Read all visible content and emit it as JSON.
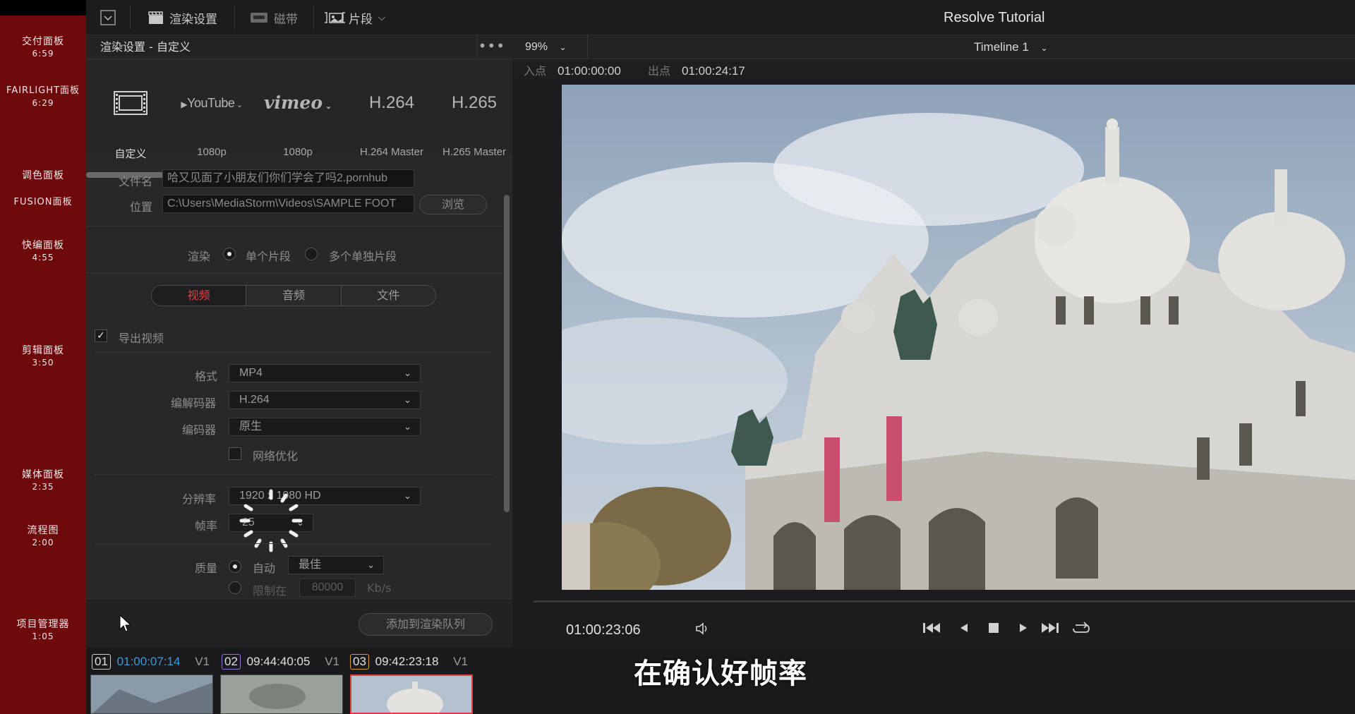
{
  "chapters": [
    {
      "label": "交付面板",
      "time": "6:59"
    },
    {
      "label": "FAIRLIGHT面板",
      "time": "6:29"
    },
    {
      "label": "调色面板",
      "time": ""
    },
    {
      "label": "FUSION面板",
      "time": ""
    },
    {
      "label": "快编面板",
      "time": "4:55"
    },
    {
      "label": "剪辑面板",
      "time": "3:50"
    },
    {
      "label": "媒体面板",
      "time": "2:35"
    },
    {
      "label": "流程图",
      "time": "2:00"
    },
    {
      "label": "项目管理器",
      "time": "1:05"
    }
  ],
  "toolbar": {
    "render_settings": "渲染设置",
    "tape": "磁带",
    "clips": "片段",
    "app_title": "Resolve Tutorial"
  },
  "render_panel": {
    "title": "渲染设置 - 自定义",
    "more": "•••",
    "presets": [
      {
        "logo": "film",
        "caption": "自定义"
      },
      {
        "logo": "YouTube",
        "caption": "1080p"
      },
      {
        "logo": "vimeo",
        "caption": "1080p"
      },
      {
        "logo": "H.264",
        "caption": "H.264 Master"
      },
      {
        "logo": "H.265",
        "caption": "H.265 Master"
      }
    ],
    "filename_label": "文件名",
    "filename_value": "哈又见面了小朋友们你们学会了吗2.pornhub",
    "location_label": "位置",
    "location_value": "C:\\Users\\MediaStorm\\Videos\\SAMPLE FOOT",
    "browse": "浏览",
    "render_label": "渲染",
    "render_single": "单个片段",
    "render_multiple": "多个单独片段",
    "tabs": [
      "视频",
      "音频",
      "文件"
    ],
    "export_video": "导出视频",
    "format_label": "格式",
    "format_value": "MP4",
    "codec_label": "编解码器",
    "codec_value": "H.264",
    "encoder_label": "编码器",
    "encoder_value": "原生",
    "network_opt": "网络优化",
    "resolution_label": "分辨率",
    "resolution_value": "1920 x 1080 HD",
    "framerate_label": "帧率",
    "framerate_value": "25",
    "quality_label": "质量",
    "quality_auto": "自动",
    "quality_value": "最佳",
    "limit_label": "限制在",
    "limit_value": "80000",
    "limit_unit": "Kb/s",
    "add_queue": "添加到渲染队列"
  },
  "viewer": {
    "zoom": "99%",
    "timeline": "Timeline 1",
    "in_label": "入点",
    "in_value": "01:00:00:00",
    "out_label": "出点",
    "out_value": "01:00:24:17",
    "timecode": "01:00:23:06"
  },
  "clips": [
    {
      "num": "01",
      "tc": "01:00:07:14",
      "track": "V1",
      "color": "#3a9bdc",
      "num_border": "#cccccc"
    },
    {
      "num": "02",
      "tc": "09:44:40:05",
      "track": "V1",
      "color": "#e0e0e0",
      "num_border": "#9a6fe0"
    },
    {
      "num": "03",
      "tc": "09:42:23:18",
      "track": "V1",
      "color": "#e0e0e0",
      "num_border": "#d4a020"
    }
  ],
  "subtitle": "在确认好帧率",
  "colors": {
    "accent_red": "#e04040",
    "sidebar": "#6e0a0c"
  }
}
